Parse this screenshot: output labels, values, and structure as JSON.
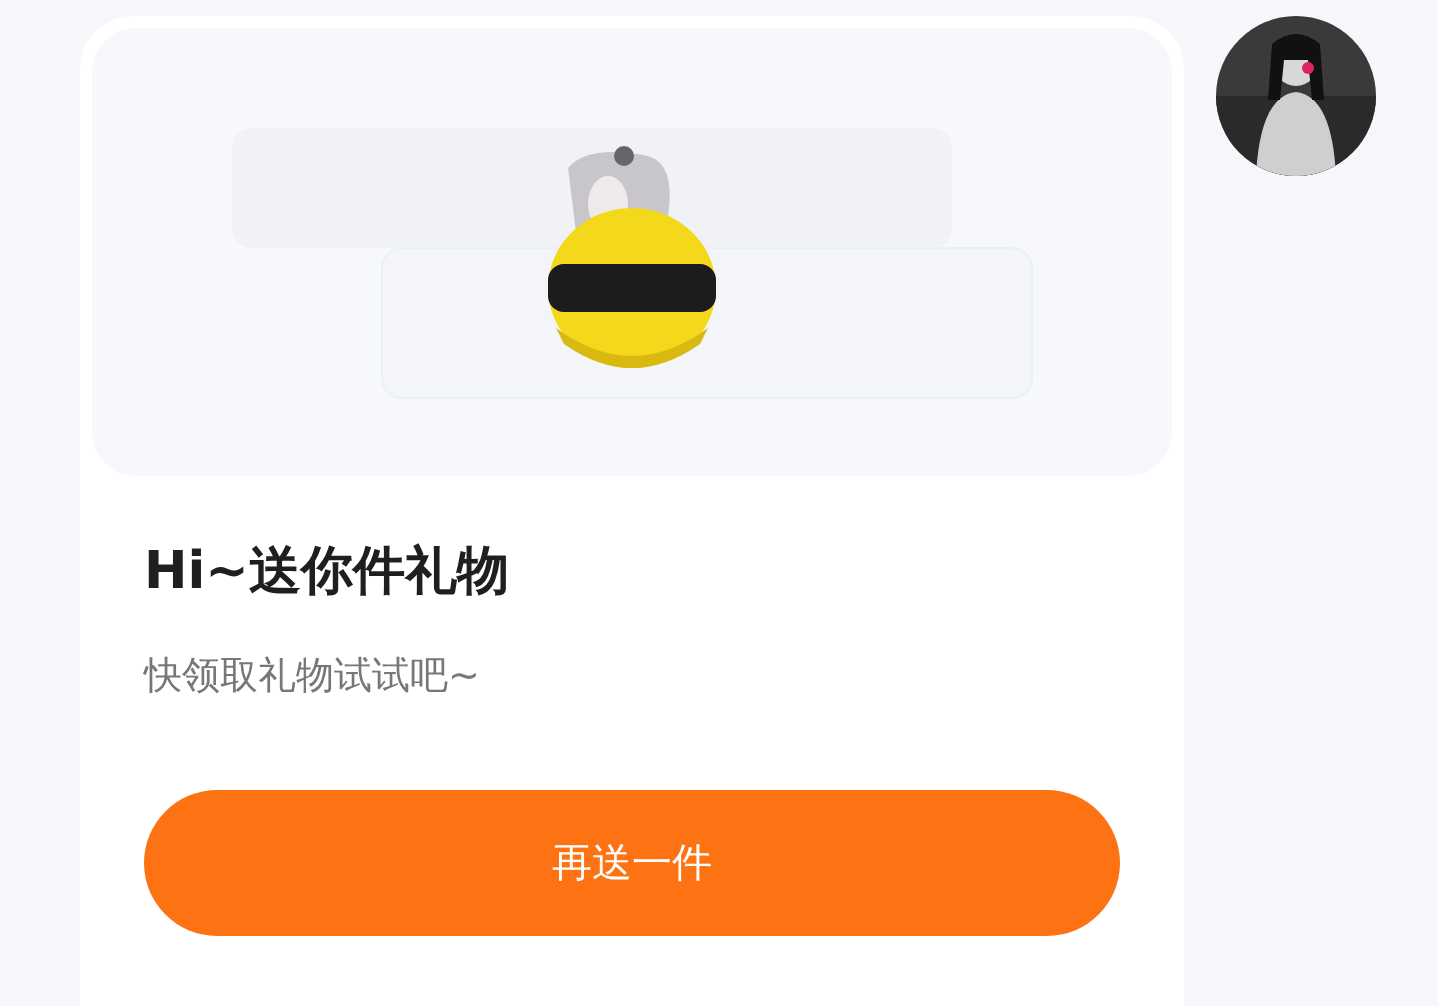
{
  "gift_card": {
    "title": "Hi~送你件礼物",
    "subtitle": "快领取礼物试试吧~",
    "button": "再送一件"
  }
}
